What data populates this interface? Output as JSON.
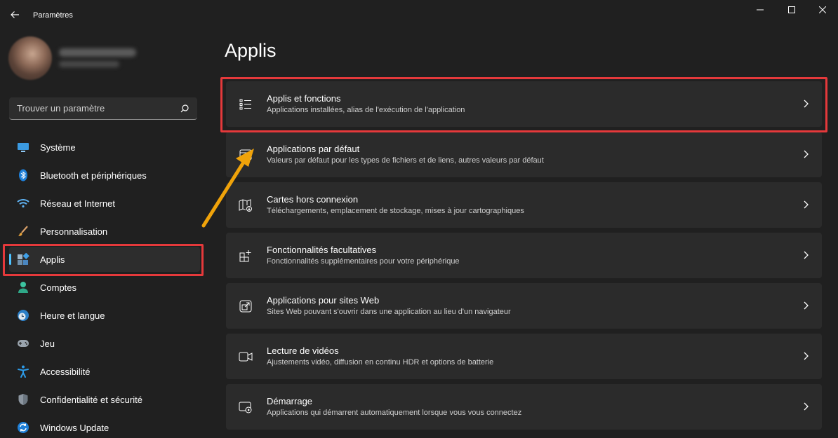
{
  "window": {
    "title": "Paramètres",
    "controls": {
      "minimize": "minimize-icon",
      "maximize": "maximize-icon",
      "close": "close-icon"
    }
  },
  "search": {
    "placeholder": "Trouver un paramètre"
  },
  "sidebar": {
    "items": [
      {
        "label": "Système",
        "icon": "monitor-icon"
      },
      {
        "label": "Bluetooth et périphériques",
        "icon": "bluetooth-icon"
      },
      {
        "label": "Réseau et Internet",
        "icon": "wifi-icon"
      },
      {
        "label": "Personnalisation",
        "icon": "brush-icon"
      },
      {
        "label": "Applis",
        "icon": "apps-icon",
        "selected": true
      },
      {
        "label": "Comptes",
        "icon": "person-icon"
      },
      {
        "label": "Heure et langue",
        "icon": "globe-clock-icon"
      },
      {
        "label": "Jeu",
        "icon": "gamepad-icon"
      },
      {
        "label": "Accessibilité",
        "icon": "accessibility-icon"
      },
      {
        "label": "Confidentialité et sécurité",
        "icon": "shield-icon"
      },
      {
        "label": "Windows Update",
        "icon": "update-icon"
      }
    ]
  },
  "main": {
    "title": "Applis",
    "cards": [
      {
        "title": "Applis et fonctions",
        "subtitle": "Applications installées, alias de l'exécution de l'application",
        "icon": "list-icon"
      },
      {
        "title": "Applications par défaut",
        "subtitle": "Valeurs par défaut pour les types de fichiers et de liens, autres valeurs par défaut",
        "icon": "default-apps-icon"
      },
      {
        "title": "Cartes hors connexion",
        "subtitle": "Téléchargements, emplacement de stockage, mises à jour cartographiques",
        "icon": "map-download-icon"
      },
      {
        "title": "Fonctionnalités facultatives",
        "subtitle": "Fonctionnalités supplémentaires pour votre périphérique",
        "icon": "add-grid-icon"
      },
      {
        "title": "Applications pour sites Web",
        "subtitle": "Sites Web pouvant s'ouvrir dans une application au lieu d'un navigateur",
        "icon": "open-in-app-icon"
      },
      {
        "title": "Lecture de vidéos",
        "subtitle": "Ajustements vidéo, diffusion en continu HDR et options de batterie",
        "icon": "video-icon"
      },
      {
        "title": "Démarrage",
        "subtitle": "Applications qui démarrent automatiquement lorsque vous vous connectez",
        "icon": "startup-icon"
      }
    ]
  },
  "colors": {
    "accent": "#4cc2ff",
    "highlight": "#e5393b",
    "arrow": "#f0a30a"
  }
}
